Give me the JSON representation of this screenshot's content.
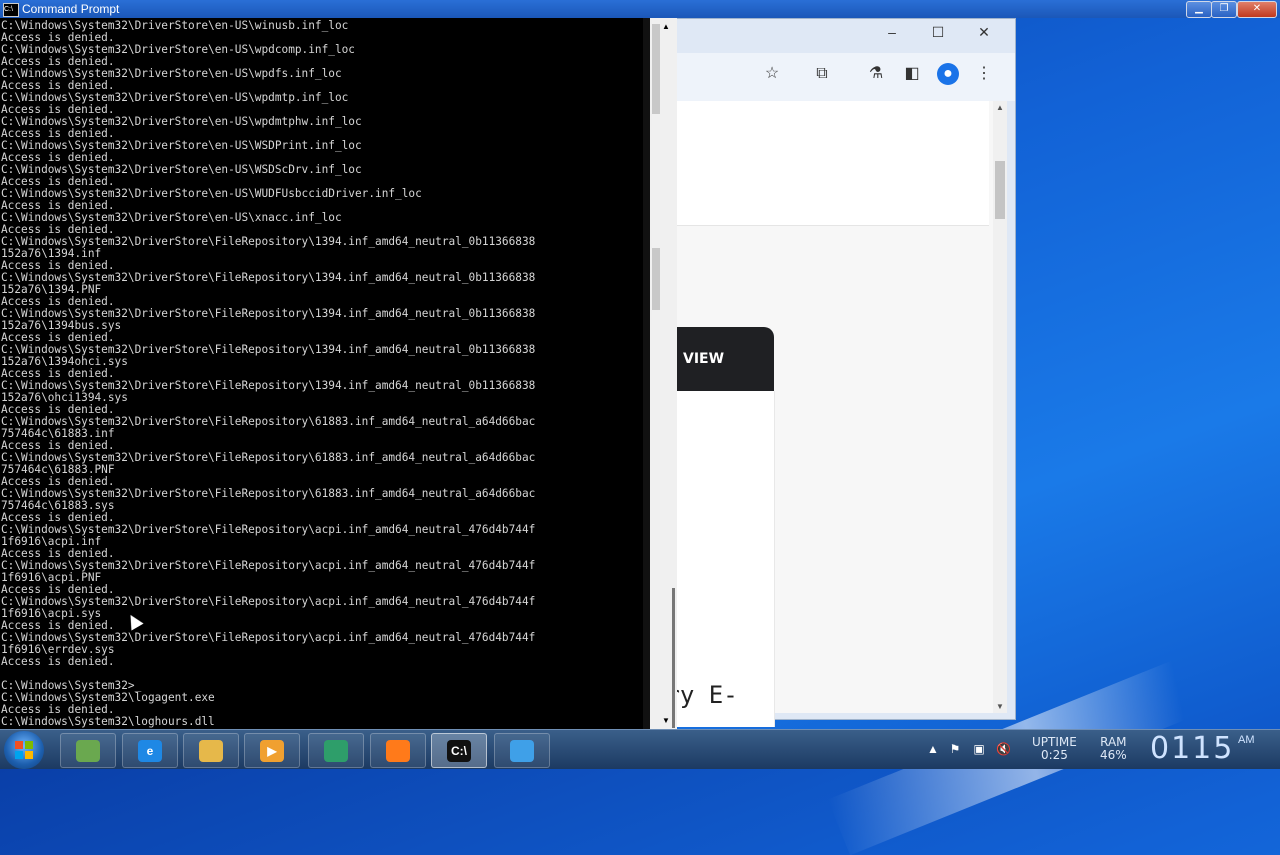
{
  "cmd_window": {
    "title": "Command Prompt",
    "icon_label": "C:\\",
    "console_lines": [
      "C:\\Windows\\System32\\DriverStore\\en-US\\winusb.inf_loc",
      "Access is denied.",
      "C:\\Windows\\System32\\DriverStore\\en-US\\wpdcomp.inf_loc",
      "Access is denied.",
      "C:\\Windows\\System32\\DriverStore\\en-US\\wpdfs.inf_loc",
      "Access is denied.",
      "C:\\Windows\\System32\\DriverStore\\en-US\\wpdmtp.inf_loc",
      "Access is denied.",
      "C:\\Windows\\System32\\DriverStore\\en-US\\wpdmtphw.inf_loc",
      "Access is denied.",
      "C:\\Windows\\System32\\DriverStore\\en-US\\WSDPrint.inf_loc",
      "Access is denied.",
      "C:\\Windows\\System32\\DriverStore\\en-US\\WSDScDrv.inf_loc",
      "Access is denied.",
      "C:\\Windows\\System32\\DriverStore\\en-US\\WUDFUsbccidDriver.inf_loc",
      "Access is denied.",
      "C:\\Windows\\System32\\DriverStore\\en-US\\xnacc.inf_loc",
      "Access is denied.",
      "C:\\Windows\\System32\\DriverStore\\FileRepository\\1394.inf_amd64_neutral_0b11366838",
      "152a76\\1394.inf",
      "Access is denied.",
      "C:\\Windows\\System32\\DriverStore\\FileRepository\\1394.inf_amd64_neutral_0b11366838",
      "152a76\\1394.PNF",
      "Access is denied.",
      "C:\\Windows\\System32\\DriverStore\\FileRepository\\1394.inf_amd64_neutral_0b11366838",
      "152a76\\1394bus.sys",
      "Access is denied.",
      "C:\\Windows\\System32\\DriverStore\\FileRepository\\1394.inf_amd64_neutral_0b11366838",
      "152a76\\1394ohci.sys",
      "Access is denied.",
      "C:\\Windows\\System32\\DriverStore\\FileRepository\\1394.inf_amd64_neutral_0b11366838",
      "152a76\\ohci1394.sys",
      "Access is denied.",
      "C:\\Windows\\System32\\DriverStore\\FileRepository\\61883.inf_amd64_neutral_a64d66bac",
      "757464c\\61883.inf",
      "Access is denied.",
      "C:\\Windows\\System32\\DriverStore\\FileRepository\\61883.inf_amd64_neutral_a64d66bac",
      "757464c\\61883.PNF",
      "Access is denied.",
      "C:\\Windows\\System32\\DriverStore\\FileRepository\\61883.inf_amd64_neutral_a64d66bac",
      "757464c\\61883.sys",
      "Access is denied.",
      "C:\\Windows\\System32\\DriverStore\\FileRepository\\acpi.inf_amd64_neutral_476d4b744f",
      "1f6916\\acpi.inf",
      "Access is denied.",
      "C:\\Windows\\System32\\DriverStore\\FileRepository\\acpi.inf_amd64_neutral_476d4b744f",
      "1f6916\\acpi.PNF",
      "Access is denied.",
      "C:\\Windows\\System32\\DriverStore\\FileRepository\\acpi.inf_amd64_neutral_476d4b744f",
      "1f6916\\acpi.sys",
      "Access is denied.",
      "C:\\Windows\\System32\\DriverStore\\FileRepository\\acpi.inf_amd64_neutral_476d4b744f",
      "1f6916\\errdev.sys",
      "Access is denied.",
      "",
      "C:\\Windows\\System32>_",
      "C:\\Windows\\System32\\logagent.exe",
      "Access is denied.",
      "C:\\Windows\\System32\\loghours.dll"
    ]
  },
  "browser": {
    "view_button_label": "VIEW",
    "partial_text": "ary E-"
  },
  "taskbar": {
    "apps": [
      {
        "name": "control-panel",
        "label": "",
        "color": "#6aa84f"
      },
      {
        "name": "internet-explorer",
        "label": "e",
        "color": "#1e88e5"
      },
      {
        "name": "file-explorer",
        "label": "",
        "color": "#e6b84a"
      },
      {
        "name": "media-player",
        "label": "▶",
        "color": "#f0a030"
      },
      {
        "name": "app-green",
        "label": "",
        "color": "#2e9e6a"
      },
      {
        "name": "firefox",
        "label": "",
        "color": "#ff7a1a"
      },
      {
        "name": "command-prompt",
        "label": "C:\\",
        "color": "#111111"
      },
      {
        "name": "app-blue",
        "label": "",
        "color": "#3fa0e8"
      }
    ],
    "uptime_label": "UPTIME",
    "uptime_value": "0:25",
    "ram_label": "RAM",
    "ram_value": "46%",
    "clock": "0115",
    "ampm": "AM"
  }
}
